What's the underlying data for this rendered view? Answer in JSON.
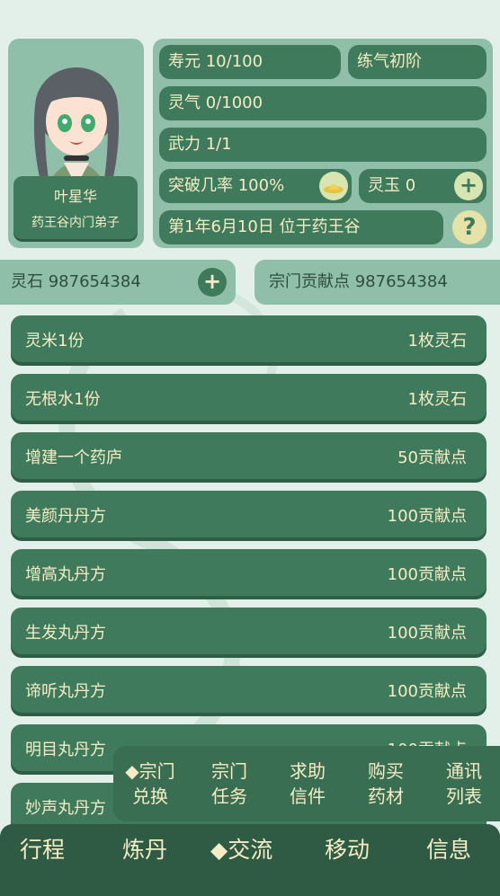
{
  "character": {
    "name": "叶星华",
    "title": "药王谷内门弟子"
  },
  "stats": {
    "lifespan": "寿元 10/100",
    "realm": "练气初阶",
    "spirit_qi": "灵气 0/1000",
    "force": "武力 1/1",
    "breakthrough": "突破几率 100%",
    "spirit_jade": "灵玉 0",
    "location": "第1年6月10日 位于药王谷"
  },
  "resources": {
    "spirit_stone": "灵石 987654384",
    "contribution": "宗门贡献点 987654384"
  },
  "items": [
    {
      "name": "灵米1份",
      "price": "1枚灵石"
    },
    {
      "name": "无根水1份",
      "price": "1枚灵石"
    },
    {
      "name": "增建一个药庐",
      "price": "50贡献点"
    },
    {
      "name": "美颜丹丹方",
      "price": "100贡献点"
    },
    {
      "name": "增高丸丹方",
      "price": "100贡献点"
    },
    {
      "name": "生发丸丹方",
      "price": "100贡献点"
    },
    {
      "name": "谛听丸丹方",
      "price": "100贡献点"
    },
    {
      "name": "明目丸丹方",
      "price": "100贡献点"
    },
    {
      "name": "妙声丸丹方",
      "price": ""
    }
  ],
  "submenu": [
    {
      "line1": "◆宗门",
      "line2": "兑换"
    },
    {
      "line1": "宗门",
      "line2": "任务"
    },
    {
      "line1": "求助",
      "line2": "信件"
    },
    {
      "line1": "购买",
      "line2": "药材"
    },
    {
      "line1": "通讯",
      "line2": "列表"
    }
  ],
  "nav": [
    "行程",
    "炼丹",
    "◆交流",
    "移动",
    "信息"
  ],
  "icons": {
    "plus": "+",
    "help": "?",
    "breakthrough": "hat-icon"
  }
}
